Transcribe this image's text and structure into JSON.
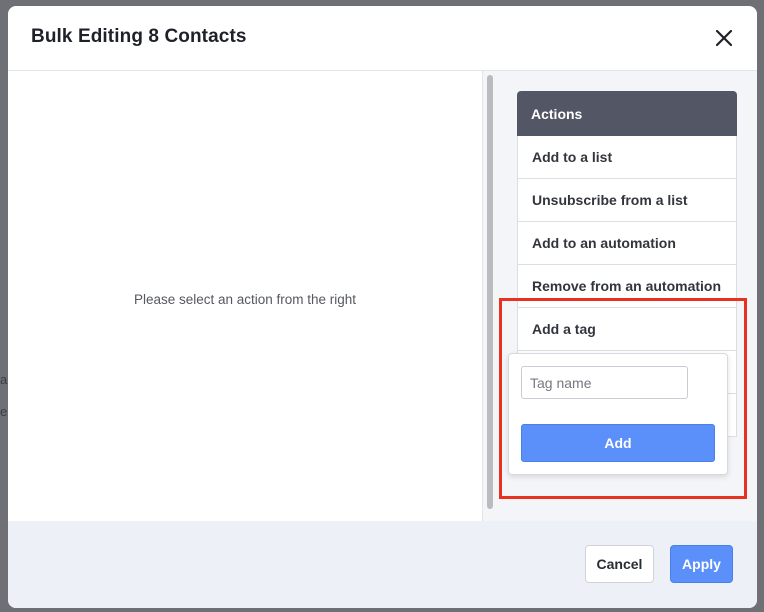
{
  "background": {
    "partial_texts": [
      "a",
      "e"
    ]
  },
  "modal": {
    "title": "Bulk Editing 8 Contacts",
    "close_icon": "close-icon",
    "empty_message": "Please select an action from the right"
  },
  "actions": {
    "header": "Actions",
    "items": [
      {
        "label": "Add to a list"
      },
      {
        "label": "Unsubscribe from a list"
      },
      {
        "label": "Add to an automation"
      },
      {
        "label": "Remove from an automation"
      },
      {
        "label": "Add a tag"
      }
    ]
  },
  "tag_popover": {
    "input_value": "",
    "input_placeholder": "Tag name",
    "add_label": "Add"
  },
  "footer": {
    "cancel_label": "Cancel",
    "apply_label": "Apply"
  },
  "colors": {
    "primary": "#5b8ff9",
    "actions_header": "#535665",
    "highlight": "#e8321f",
    "footer_bg": "#eef0f8"
  }
}
